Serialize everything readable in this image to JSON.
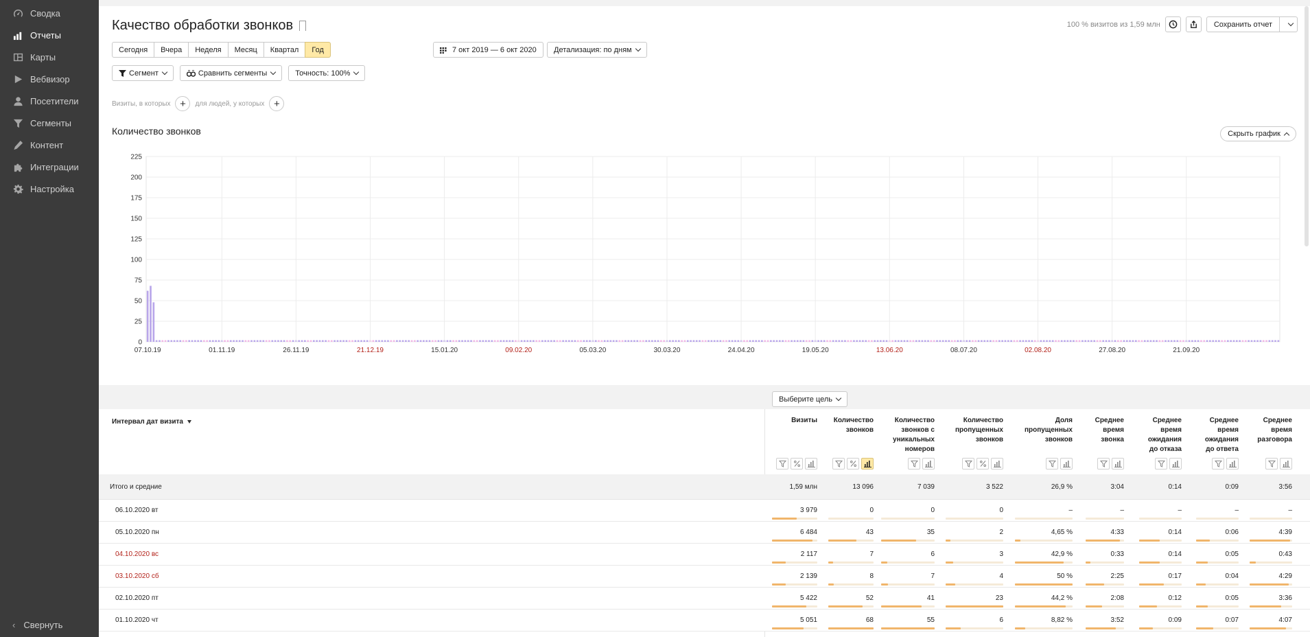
{
  "sidebar": {
    "items": [
      {
        "label": "Сводка",
        "icon": "gauge-icon",
        "active": false
      },
      {
        "label": "Отчеты",
        "icon": "bar-chart-icon",
        "active": true
      },
      {
        "label": "Карты",
        "icon": "map-icon",
        "active": false
      },
      {
        "label": "Вебвизор",
        "icon": "play-icon",
        "active": false
      },
      {
        "label": "Посетители",
        "icon": "person-icon",
        "active": false
      },
      {
        "label": "Сегменты",
        "icon": "funnel-icon",
        "active": false
      },
      {
        "label": "Контент",
        "icon": "pencil-icon",
        "active": false
      },
      {
        "label": "Интеграции",
        "icon": "puzzle-icon",
        "active": false
      },
      {
        "label": "Настройка",
        "icon": "gear-icon",
        "active": false
      }
    ],
    "collapse_label": "Свернуть"
  },
  "header": {
    "title": "Качество обработки звонков",
    "sample_info": "100 % визитов из 1,59 млн",
    "save_label": "Сохранить отчет"
  },
  "period": {
    "buttons": [
      "Сегодня",
      "Вчера",
      "Неделя",
      "Месяц",
      "Квартал",
      "Год"
    ],
    "selected": "Год",
    "date_range": "7 окт 2019 — 6 окт 2020",
    "detail_label": "Детализация: по дням"
  },
  "controls": {
    "segment": "Сегмент",
    "compare": "Сравнить сегменты",
    "accuracy": "Точность: 100%"
  },
  "filters": {
    "visits_label": "Визиты, в которых",
    "people_label": "для людей, у которых"
  },
  "chart": {
    "title": "Количество звонков",
    "hide_label": "Скрыть график",
    "accent": "#b9a6ea",
    "weekend_color": "#f0b6e6"
  },
  "chart_data": {
    "type": "bar",
    "title": "Количество звонков",
    "xlabel": "",
    "ylabel": "",
    "ylim": [
      0,
      225
    ],
    "yticks": [
      0,
      25,
      50,
      75,
      100,
      125,
      150,
      175,
      200,
      225
    ],
    "xtick_labels": [
      {
        "label": "07.10.19",
        "weekend": false
      },
      {
        "label": "01.11.19",
        "weekend": false
      },
      {
        "label": "26.11.19",
        "weekend": false
      },
      {
        "label": "21.12.19",
        "weekend": true
      },
      {
        "label": "15.01.20",
        "weekend": false
      },
      {
        "label": "09.02.20",
        "weekend": true
      },
      {
        "label": "05.03.20",
        "weekend": false
      },
      {
        "label": "30.03.20",
        "weekend": false
      },
      {
        "label": "24.04.20",
        "weekend": false
      },
      {
        "label": "19.05.20",
        "weekend": false
      },
      {
        "label": "13.06.20",
        "weekend": true
      },
      {
        "label": "08.07.20",
        "weekend": false
      },
      {
        "label": "02.08.20",
        "weekend": true
      },
      {
        "label": "27.08.20",
        "weekend": false
      },
      {
        "label": "21.09.20",
        "weekend": false
      }
    ],
    "start_weekday": 1,
    "grid": true,
    "series": [
      {
        "values": [
          62,
          68,
          48,
          2,
          2,
          2,
          2,
          2,
          2,
          2,
          2,
          2,
          2,
          2,
          2,
          2,
          2,
          2,
          2,
          2,
          2,
          2,
          2,
          2,
          2,
          2,
          2,
          2,
          2,
          2,
          2,
          2,
          2,
          2,
          2,
          2,
          2,
          2,
          2,
          2,
          2,
          2,
          2,
          2,
          2,
          2,
          2,
          2,
          2,
          2,
          2,
          2,
          2,
          2,
          2,
          2,
          2,
          2,
          2,
          2,
          2,
          2,
          2,
          2,
          2,
          2,
          2,
          2,
          2,
          2,
          2,
          2,
          2,
          2,
          2,
          2,
          2,
          2,
          2,
          2,
          2,
          2,
          2,
          2,
          2,
          2,
          2,
          2,
          2,
          2,
          2,
          2,
          2,
          2,
          2,
          2,
          2,
          2,
          2,
          2,
          2,
          2,
          2,
          2,
          2,
          2,
          2,
          2,
          2,
          2,
          2,
          2,
          2,
          2,
          2,
          2,
          2,
          2,
          2,
          2,
          2,
          2,
          2,
          2,
          2,
          2,
          2,
          2,
          2,
          2,
          2,
          2,
          2,
          2,
          2,
          2,
          2,
          2,
          2,
          2,
          2,
          2,
          2,
          2,
          2,
          2,
          2,
          2,
          2,
          2,
          2,
          2,
          2,
          2,
          2,
          2,
          2,
          2,
          2,
          2,
          2,
          2,
          2,
          2,
          2,
          2,
          2,
          2,
          2,
          2,
          2,
          2,
          2,
          2,
          2,
          2,
          2,
          2,
          2,
          2,
          2,
          2,
          2,
          2,
          2,
          2,
          2,
          2,
          2,
          2,
          2,
          2,
          2,
          2,
          2,
          2,
          2,
          2,
          2,
          2,
          2,
          2,
          2,
          2,
          2,
          2,
          2,
          2,
          2,
          2,
          2,
          2,
          2,
          2,
          2,
          2,
          2,
          2,
          2,
          2,
          2,
          2,
          2,
          2,
          2,
          2,
          2,
          2,
          2,
          2,
          2,
          2,
          2,
          2,
          2,
          2,
          2,
          2,
          2,
          2,
          2,
          2,
          2,
          2,
          2,
          2,
          2,
          2,
          2,
          2,
          2,
          2,
          2,
          2,
          2,
          2,
          2,
          2,
          2,
          2,
          2,
          2,
          2,
          2,
          2,
          2,
          2,
          2,
          2,
          2,
          2,
          2,
          2,
          2,
          2,
          2,
          2,
          2,
          2,
          2,
          2,
          2,
          2,
          2,
          2,
          2,
          2,
          2,
          2,
          2,
          2,
          2,
          2,
          2,
          2,
          2,
          2,
          2,
          2,
          2,
          2,
          2,
          2,
          2,
          2,
          2,
          2,
          2,
          2,
          2,
          2,
          2,
          2,
          2,
          2,
          2,
          2,
          2,
          2,
          2,
          2,
          2,
          2,
          2,
          2,
          2,
          2,
          2,
          2,
          2,
          2,
          2,
          2,
          2,
          2,
          2,
          2,
          2,
          2,
          2,
          2,
          2,
          2,
          2,
          2,
          2,
          2,
          2,
          2,
          2,
          2,
          2,
          2,
          2,
          2,
          2,
          2,
          2,
          2,
          2,
          2,
          2,
          2,
          2,
          2,
          2,
          2,
          2,
          2,
          2,
          2,
          2,
          2,
          2,
          2,
          2,
          2,
          2,
          2,
          2,
          2,
          2
        ]
      }
    ]
  },
  "table": {
    "goal_button": "Выберите цель",
    "dimension_header": "Интервал дат визита",
    "columns": [
      {
        "label": "Визиты",
        "lines": [
          "Визиты"
        ]
      },
      {
        "label": "Количество звонков",
        "lines": [
          "Количество",
          "звонков"
        ]
      },
      {
        "label": "Количество звонков с уникальных номеров",
        "lines": [
          "Количество",
          "звонков с",
          "уникальных",
          "номеров"
        ]
      },
      {
        "label": "Количество пропущенных звонков",
        "lines": [
          "Количество",
          "пропущенных",
          "звонков"
        ]
      },
      {
        "label": "Доля пропущенных звонков",
        "lines": [
          "Доля",
          "пропущенных",
          "звонков"
        ]
      },
      {
        "label": "Среднее время звонка",
        "lines": [
          "Среднее",
          "время",
          "звонка"
        ]
      },
      {
        "label": "Среднее время ожидания до отказа",
        "lines": [
          "Среднее",
          "время",
          "ожидания",
          "до отказа"
        ]
      },
      {
        "label": "Среднее время ожидания до ответа",
        "lines": [
          "Среднее",
          "время",
          "ожидания",
          "до ответа"
        ]
      },
      {
        "label": "Среднее время разговора",
        "lines": [
          "Среднее",
          "время",
          "разговора"
        ]
      }
    ],
    "total": {
      "label": "Итого и средние",
      "values": [
        "1,59 млн",
        "13 096",
        "7 039",
        "3 522",
        "26,9 %",
        "3:04",
        "0:14",
        "0:09",
        "3:56"
      ]
    },
    "rows": [
      {
        "label": "06.10.2020 вт",
        "weekend": false,
        "values": [
          "3 979",
          "0",
          "0",
          "0",
          "–",
          "–",
          "–",
          "–",
          "–"
        ],
        "fills": [
          0.55,
          0,
          0,
          0,
          0,
          0,
          0,
          0,
          0
        ]
      },
      {
        "label": "05.10.2020 пн",
        "weekend": false,
        "values": [
          "6 484",
          "43",
          "35",
          "2",
          "4,65 %",
          "4:33",
          "0:14",
          "0:06",
          "4:39"
        ],
        "fills": [
          0.9,
          0.62,
          0.65,
          0.08,
          0.1,
          0.9,
          0.48,
          0.33,
          0.95
        ]
      },
      {
        "label": "04.10.2020 вс",
        "weekend": true,
        "values": [
          "2 117",
          "7",
          "6",
          "3",
          "42,9 %",
          "0:33",
          "0:14",
          "0:05",
          "0:43"
        ],
        "fills": [
          0.3,
          0.1,
          0.11,
          0.13,
          0.85,
          0.12,
          0.48,
          0.28,
          0.15
        ]
      },
      {
        "label": "03.10.2020 сб",
        "weekend": true,
        "values": [
          "2 139",
          "8",
          "7",
          "4",
          "50 %",
          "2:25",
          "0:17",
          "0:04",
          "4:29"
        ],
        "fills": [
          0.3,
          0.12,
          0.13,
          0.17,
          1.0,
          0.48,
          0.58,
          0.22,
          0.92
        ]
      },
      {
        "label": "02.10.2020 пт",
        "weekend": false,
        "values": [
          "5 422",
          "52",
          "41",
          "23",
          "44,2 %",
          "2:08",
          "0:12",
          "0:05",
          "3:36"
        ],
        "fills": [
          0.76,
          0.75,
          0.76,
          1.0,
          0.88,
          0.42,
          0.42,
          0.28,
          0.74
        ]
      },
      {
        "label": "01.10.2020 чт",
        "weekend": false,
        "values": [
          "5 051",
          "68",
          "55",
          "6",
          "8,82 %",
          "3:52",
          "0:09",
          "0:07",
          "4:07"
        ],
        "fills": [
          0.7,
          1.0,
          1.0,
          0.26,
          0.18,
          0.78,
          0.32,
          0.4,
          0.85
        ]
      }
    ]
  }
}
